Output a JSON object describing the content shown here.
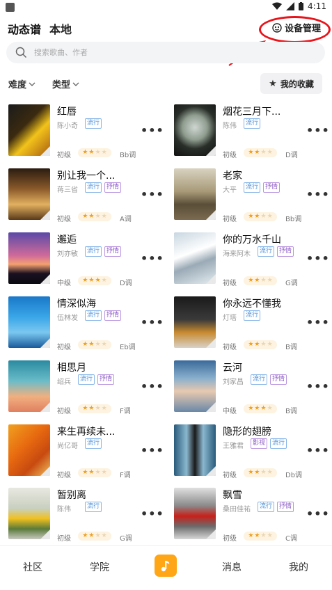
{
  "status_bar": {
    "time": "4:11"
  },
  "header": {
    "tab_main": "动态谱",
    "tab_local": "本地",
    "device_manage": "设备管理"
  },
  "search": {
    "placeholder": "搜索歌曲、作者"
  },
  "filters": {
    "difficulty": "难度",
    "type": "类型",
    "favorites": "我的收藏"
  },
  "songs": [
    {
      "title": "红唇",
      "singer": "陈小奇",
      "tags": [
        "流行"
      ],
      "level": "初级",
      "stars": 2,
      "key": "Bb调"
    },
    {
      "title": "烟花三月下...",
      "singer": "陈伟",
      "tags": [
        "流行"
      ],
      "level": "初级",
      "stars": 2,
      "key": "D调"
    },
    {
      "title": "别让我一个...",
      "singer": "蒋三省",
      "tags": [
        "流行",
        "抒情"
      ],
      "level": "初级",
      "stars": 2,
      "key": "A调"
    },
    {
      "title": "老家",
      "singer": "大平",
      "tags": [
        "流行",
        "抒情"
      ],
      "level": "初级",
      "stars": 2,
      "key": "Bb调"
    },
    {
      "title": "邂逅",
      "singer": "刘亦敏",
      "tags": [
        "流行",
        "抒情"
      ],
      "level": "中级",
      "stars": 3,
      "key": "D调"
    },
    {
      "title": "你的万水千山",
      "singer": "海来阿木",
      "tags": [
        "流行",
        "抒情"
      ],
      "level": "初级",
      "stars": 2,
      "key": "G调"
    },
    {
      "title": "情深似海",
      "singer": "伍林发",
      "tags": [
        "流行",
        "抒情"
      ],
      "level": "初级",
      "stars": 2,
      "key": "Eb调"
    },
    {
      "title": "你永远不懂我",
      "singer": "灯塔",
      "tags": [
        "流行"
      ],
      "level": "初级",
      "stars": 2,
      "key": "B调"
    },
    {
      "title": "相思月",
      "singer": "绍兵",
      "tags": [
        "流行",
        "抒情"
      ],
      "level": "初级",
      "stars": 2,
      "key": "F调"
    },
    {
      "title": "云河",
      "singer": "刘家昌",
      "tags": [
        "流行",
        "抒情"
      ],
      "level": "中级",
      "stars": 3,
      "key": "B调"
    },
    {
      "title": "来生再续未...",
      "singer": "尚亿哥",
      "tags": [
        "流行"
      ],
      "level": "初级",
      "stars": 2,
      "key": "F调"
    },
    {
      "title": "隐形的翅膀",
      "singer": "王雅君",
      "tags": [
        "影视",
        "流行"
      ],
      "level": "初级",
      "stars": 2,
      "key": "Db调"
    },
    {
      "title": "暂别离",
      "singer": "陈伟",
      "tags": [
        "流行"
      ],
      "level": "初级",
      "stars": 2,
      "key": "G调"
    },
    {
      "title": "飘雪",
      "singer": "桑田佳祐",
      "tags": [
        "流行",
        "抒情"
      ],
      "level": "初级",
      "stars": 2,
      "key": "C调"
    }
  ],
  "tabbar": {
    "community": "社区",
    "academy": "学院",
    "messages": "消息",
    "mine": "我的"
  },
  "colors": {
    "accent": "#ffa616",
    "annotation": "#e8141b",
    "tag_blue": "#4a8fd8",
    "tag_purple": "#8a58c4",
    "star": "#f0a020"
  }
}
